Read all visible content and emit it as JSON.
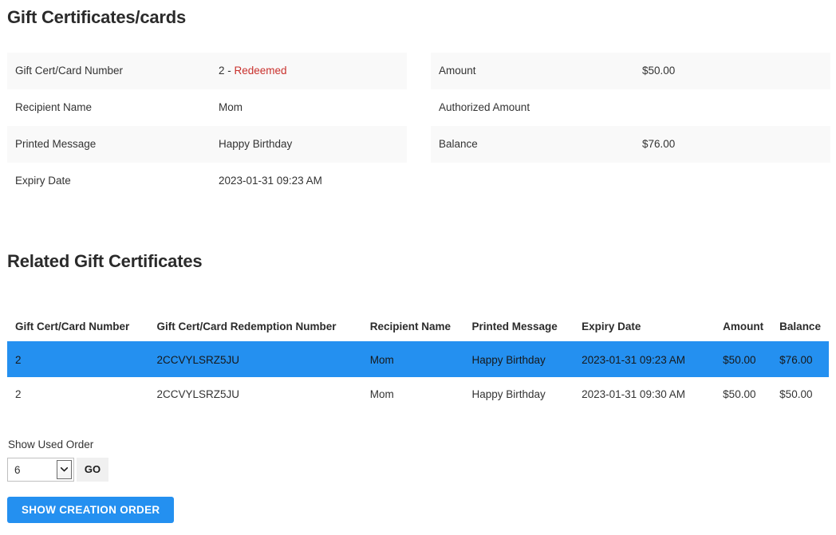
{
  "page": {
    "title": "Gift Certificates/cards",
    "section_title": "Related Gift Certificates"
  },
  "colors": {
    "accent": "#2490f0",
    "status_redeemed": "#c9302c",
    "stripe": "#f9f9f9"
  },
  "details": {
    "left": [
      {
        "label": "Gift Cert/Card Number",
        "value": "2 - ",
        "status": "Redeemed"
      },
      {
        "label": "Recipient Name",
        "value": "Mom",
        "status": ""
      },
      {
        "label": "Printed Message",
        "value": "Happy Birthday",
        "status": ""
      },
      {
        "label": "Expiry Date",
        "value": "2023-01-31 09:23 AM",
        "status": ""
      }
    ],
    "right": [
      {
        "label": "Amount",
        "value": "$50.00"
      },
      {
        "label": "Authorized Amount",
        "value": ""
      },
      {
        "label": "Balance",
        "value": "$76.00"
      }
    ]
  },
  "related_table": {
    "headers": [
      "Gift Cert/Card Number",
      "Gift Cert/Card Redemption Number",
      "Recipient Name",
      "Printed Message",
      "Expiry Date",
      "Amount",
      "Balance"
    ],
    "rows": [
      {
        "selected": true,
        "number": "2",
        "redemption_number": "2CCVYLSRZ5JU",
        "recipient_name": "Mom",
        "printed_message": "Happy Birthday",
        "expiry_date": "2023-01-31 09:23 AM",
        "amount": "$50.00",
        "balance": "$76.00"
      },
      {
        "selected": false,
        "number": "2",
        "redemption_number": "2CCVYLSRZ5JU",
        "recipient_name": "Mom",
        "printed_message": "Happy Birthday",
        "expiry_date": "2023-01-31 09:30 AM",
        "amount": "$50.00",
        "balance": "$50.00"
      }
    ]
  },
  "controls": {
    "show_used_order_label": "Show Used Order",
    "order_select_value": "6",
    "order_select_options": [
      "6"
    ],
    "go_label": "GO",
    "show_creation_order_label": "SHOW CREATION ORDER"
  }
}
